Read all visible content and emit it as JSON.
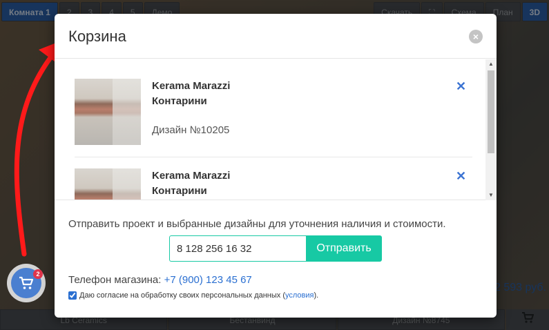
{
  "background": {
    "tabs": [
      "Комната 1",
      "2",
      "3",
      "4",
      "5",
      "Демо"
    ],
    "top_right": [
      "Скачать",
      "⛶",
      "Схема",
      "План",
      "3D"
    ],
    "bottom_items": [
      "Lb Ceramics",
      "Бестанвинд",
      "Дизайн №8745"
    ],
    "price": "2 593 руб."
  },
  "cart_bubble": {
    "badge": "2"
  },
  "modal": {
    "title": "Корзина",
    "close": "×",
    "items": [
      {
        "brand": "Kerama Marazzi",
        "collection": "Контарини",
        "design": "Дизайн №10205",
        "remove": "✕"
      },
      {
        "brand": "Kerama Marazzi",
        "collection": "Контарини",
        "design": "",
        "remove": "✕"
      }
    ],
    "send_text": "Отправить проект и выбранные дизайны для уточнения наличия и стоимости.",
    "phone_value": "8 128 256 16 32",
    "send_button": "Отправить",
    "shop_phone_label": "Телефон магазина:",
    "shop_phone": "+7 (900) 123 45 67",
    "consent_text": "Даю согласие на обработку своих персональных данных (",
    "consent_link": "условия",
    "consent_end": ")."
  }
}
